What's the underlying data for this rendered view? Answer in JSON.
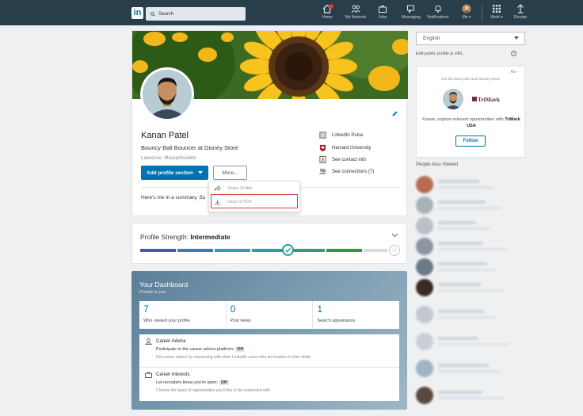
{
  "nav": {
    "search_placeholder": "Search",
    "items": [
      {
        "label": "Home",
        "icon": "home-icon"
      },
      {
        "label": "My Network",
        "icon": "people-icon"
      },
      {
        "label": "Jobs",
        "icon": "briefcase-icon"
      },
      {
        "label": "Messaging",
        "icon": "messaging-icon"
      },
      {
        "label": "Notifications",
        "icon": "bell-icon"
      },
      {
        "label": "Me ▾",
        "icon": "avatar-icon"
      },
      {
        "label": "Work ▾",
        "icon": "grid-icon"
      },
      {
        "label": "Elevate",
        "icon": "elevate-icon"
      }
    ]
  },
  "profile": {
    "name": "Kanan Patel",
    "headline": "Bouncy Ball Bouncer at Disney Store",
    "location": "Lawrence, Massachusetts",
    "add_section_label": "Add profile section",
    "more_label": "More...",
    "summary": "Here's me in a summary. Su",
    "links": [
      {
        "label": "LinkedIn Pulse",
        "icon": "pulse-icon"
      },
      {
        "label": "Harvard University",
        "icon": "school-icon"
      },
      {
        "label": "See contact info",
        "icon": "contact-icon"
      },
      {
        "label": "See connections (7)",
        "icon": "connections-icon"
      }
    ]
  },
  "more_menu": {
    "items": [
      {
        "label": "Share Profile",
        "icon": "share-icon"
      },
      {
        "label": "Save to PDF",
        "icon": "download-icon"
      }
    ],
    "highlighted": "Save to PDF"
  },
  "strength": {
    "label": "Profile Strength:",
    "level": "Intermediate",
    "progress": 0.57,
    "segment_colors": [
      "#4a56a8",
      "#3a7cc0",
      "#2f9bb5",
      "#2aa09a",
      "#2fa06d",
      "#2f9a4d",
      "#d8dde1"
    ]
  },
  "dashboard": {
    "title": "Your Dashboard",
    "subtitle": "Private to you",
    "stats": [
      {
        "value": "7",
        "label": "Who viewed your profile"
      },
      {
        "value": "0",
        "label": "Post views"
      },
      {
        "value": "1",
        "label": "Search appearance"
      }
    ],
    "career_advice": {
      "title": "Career Advice",
      "line": "Participate in the career advice platform:",
      "state": "Off",
      "description": "Get career advice by conversing with other LinkedIn users who are leaders in their fields"
    },
    "career_interests": {
      "title": "Career interests",
      "line": "Let recruiters know you're open:",
      "state": "Off",
      "description": "Choose the types of opportunities you'd like to be connected with"
    }
  },
  "sidebar": {
    "language": "English",
    "edit_public": "Edit public profile & URL",
    "ad": {
      "ad_label": "Ad ···",
      "tagline": "Get the latest jobs and industry news",
      "brand": "TriMark",
      "message": "Kanan, explore relevant opportunities with",
      "company": "TriMark USA",
      "follow_label": "Follow"
    },
    "people_also_viewed": "People Also Viewed"
  },
  "colors": {
    "nav_bg": "#283e4a",
    "brand_blue": "#0073b1",
    "highlight_red": "#d23d3d"
  }
}
